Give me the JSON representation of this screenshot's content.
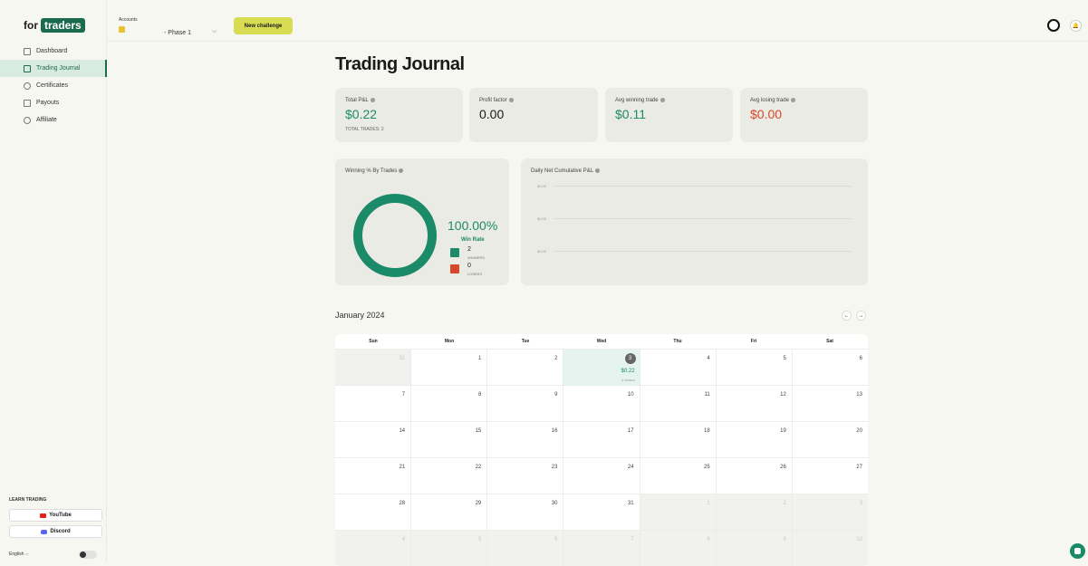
{
  "brand": {
    "for": "for",
    "name": "traders"
  },
  "sidebar": {
    "items": [
      {
        "label": "Dashboard",
        "icon": "dashboard-icon",
        "active": false
      },
      {
        "label": "Trading Journal",
        "icon": "book-icon",
        "active": true
      },
      {
        "label": "Certificates",
        "icon": "certificate-icon",
        "active": false
      },
      {
        "label": "Payouts",
        "icon": "wallet-icon",
        "active": false
      },
      {
        "label": "Affiliate",
        "icon": "link-icon",
        "active": false
      }
    ],
    "learn_title": "LEARN TRADING",
    "youtube": "YouTube",
    "discord": "Discord",
    "language": "English"
  },
  "topbar": {
    "accounts_label": "Accounts",
    "account_name": "- Phase 1",
    "new_challenge": "New challenge"
  },
  "page_title": "Trading Journal",
  "stats": {
    "total_pnl_label": "Total P&L",
    "total_pnl_value": "$0.22",
    "total_trades": "TOTAL TRADES: 2",
    "profit_factor_label": "Profit factor",
    "profit_factor_value": "0.00",
    "avg_win_label": "Avg winning trade",
    "avg_win_value": "$0.11",
    "avg_loss_label": "Avg losing trade",
    "avg_loss_value": "$0.00"
  },
  "winrate": {
    "title": "Winning % By Trades",
    "percent": "100.00%",
    "label": "Win Rate",
    "winners_count": "2",
    "winners_label": "WINNERS",
    "losers_count": "0",
    "losers_label": "LOSERS",
    "win_fraction": 1.0
  },
  "cumulative": {
    "title": "Daily Net Cumulative P&L",
    "y_ticks": [
      "$0.00",
      "$0.00",
      "$0.00"
    ]
  },
  "calendar": {
    "month": "January 2024",
    "weekdays": [
      "Sun",
      "Mon",
      "Tue",
      "Wed",
      "Thu",
      "Fri",
      "Sat"
    ],
    "weeks": [
      [
        {
          "d": "31",
          "out": true
        },
        {
          "d": "1"
        },
        {
          "d": "2"
        },
        {
          "d": "3",
          "trade": true,
          "pnl": "$0.22",
          "trades": "2 trades"
        },
        {
          "d": "4"
        },
        {
          "d": "5"
        },
        {
          "d": "6"
        }
      ],
      [
        {
          "d": "7"
        },
        {
          "d": "8"
        },
        {
          "d": "9"
        },
        {
          "d": "10"
        },
        {
          "d": "11"
        },
        {
          "d": "12"
        },
        {
          "d": "13"
        }
      ],
      [
        {
          "d": "14"
        },
        {
          "d": "15"
        },
        {
          "d": "16"
        },
        {
          "d": "17"
        },
        {
          "d": "18"
        },
        {
          "d": "19"
        },
        {
          "d": "20"
        }
      ],
      [
        {
          "d": "21"
        },
        {
          "d": "22"
        },
        {
          "d": "23"
        },
        {
          "d": "24"
        },
        {
          "d": "25"
        },
        {
          "d": "26"
        },
        {
          "d": "27"
        }
      ],
      [
        {
          "d": "28"
        },
        {
          "d": "29"
        },
        {
          "d": "30"
        },
        {
          "d": "31"
        },
        {
          "d": "1",
          "out": true
        },
        {
          "d": "2",
          "out": true
        },
        {
          "d": "3",
          "out": true
        }
      ],
      [
        {
          "d": "4",
          "out": true
        },
        {
          "d": "5",
          "out": true
        },
        {
          "d": "6",
          "out": true
        },
        {
          "d": "7",
          "out": true
        },
        {
          "d": "8",
          "out": true
        },
        {
          "d": "9",
          "out": true
        },
        {
          "d": "10",
          "out": true
        }
      ]
    ]
  },
  "colors": {
    "accent": "#1b8a69",
    "loss": "#d9472b",
    "cta": "#d7dc52"
  }
}
